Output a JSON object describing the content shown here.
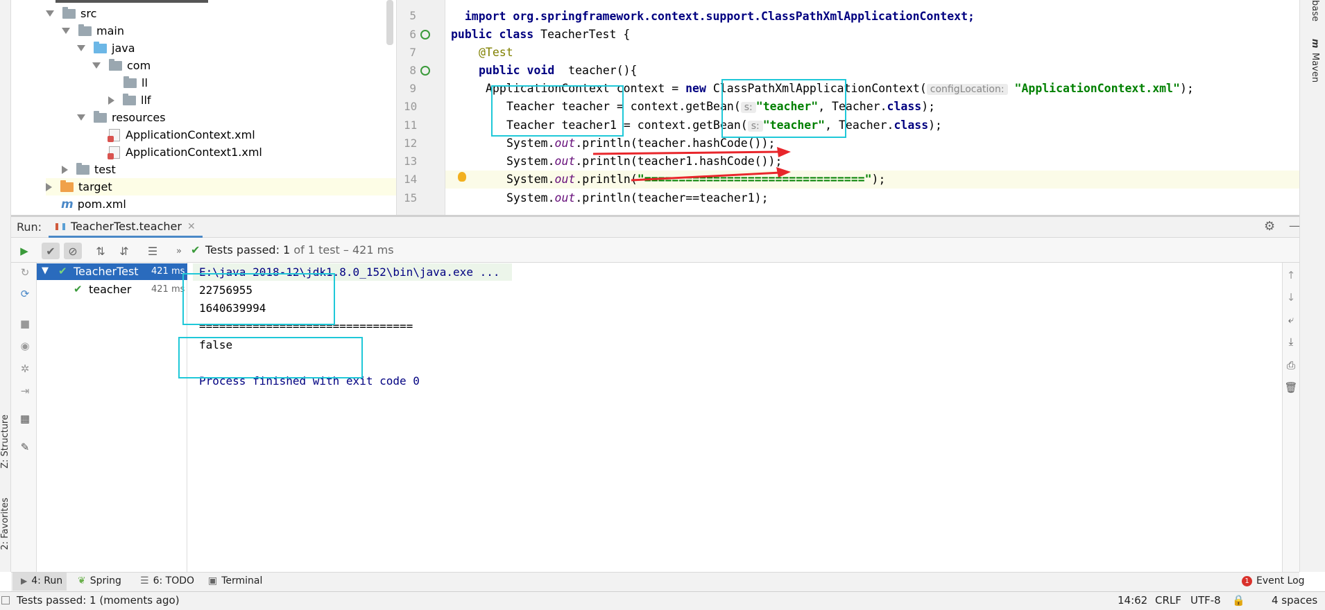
{
  "project_tree": {
    "items": [
      {
        "label": "src",
        "type": "folder-grey",
        "expanded": true
      },
      {
        "label": "main",
        "type": "folder-grey",
        "expanded": true
      },
      {
        "label": "java",
        "type": "folder-blue",
        "expanded": true
      },
      {
        "label": "com",
        "type": "package",
        "expanded": true
      },
      {
        "label": "ll",
        "type": "package"
      },
      {
        "label": "llf",
        "type": "package",
        "expanded": false
      },
      {
        "label": "resources",
        "type": "folder-res",
        "expanded": true
      },
      {
        "label": "ApplicationContext.xml",
        "type": "xml"
      },
      {
        "label": "ApplicationContext1.xml",
        "type": "xml"
      },
      {
        "label": "test",
        "type": "folder-grey",
        "expanded": false
      },
      {
        "label": "target",
        "type": "folder-orange",
        "expanded": false
      },
      {
        "label": "pom.xml",
        "type": "maven"
      }
    ]
  },
  "editor": {
    "line_numbers": [
      "5",
      "6",
      "7",
      "8",
      "9",
      "10",
      "11",
      "12",
      "13",
      "14",
      "15"
    ],
    "partial_top_line": "import org.springframework.context.support.ClassPathXmlApplicationContext;",
    "code": {
      "l6_kw": "public class ",
      "l6_rest": "TeacherTest {",
      "l7_ann": "@Test",
      "l8_kw": "public void ",
      "l8_rest": " teacher(){",
      "l9_a": "ApplicationContext context = ",
      "l9_kw": "new",
      "l9_b": " ClassPathXmlApplicationContext(",
      "l9_hint": "configLocation:",
      "l9_str": "\"ApplicationContext.xml\"",
      "l9_end": ");",
      "l10_a": "Teacher teacher = context.getBean(",
      "l10_hint": "s:",
      "l10_str": "\"teacher\"",
      "l10_b": ", Teacher.",
      "l10_kw": "class",
      "l10_end": ");",
      "l11_a": "Teacher teacher1 = context.getBean(",
      "l11_hint": "s:",
      "l11_str": "\"teacher\"",
      "l11_b": ", Teacher.",
      "l11_kw": "class",
      "l11_end": ");",
      "l12_a": "System.",
      "l12_fld": "out",
      "l12_b": ".println(teacher.hashCode());",
      "l13_a": "System.",
      "l13_fld": "out",
      "l13_b": ".println(teacher1.hashCode());",
      "l14_a": "System.",
      "l14_fld": "out",
      "l14_b": ".println(",
      "l14_str": "\"================================\"",
      "l14_end": ");",
      "l15_a": "System.",
      "l15_fld": "out",
      "l15_b": ".println(teacher==teacher1);"
    }
  },
  "run_panel": {
    "label": "Run:",
    "tab": "TeacherTest.teacher",
    "status_prefix": "Tests passed: ",
    "status_count": "1",
    "status_suffix": " of 1 test – 421 ms",
    "tree": [
      {
        "label": "TeacherTest",
        "time": "421 ms",
        "selected": true
      },
      {
        "label": "teacher",
        "time": "421 ms"
      }
    ],
    "console": {
      "cmd": "E:\\java 2018-12\\jdk1.8.0_152\\bin\\java.exe ...",
      "out1": "22756955",
      "out2": "1640639994",
      "sep": "================================",
      "result": "false",
      "finish": "Process finished with exit code 0"
    }
  },
  "bottom_tabs": {
    "run": "4: Run",
    "spring": "Spring",
    "todo": "6: TODO",
    "terminal": "Terminal",
    "event_log": "Event Log",
    "event_count": "1"
  },
  "status_bar": {
    "message": "Tests passed: 1 (moments ago)",
    "position": "14:62",
    "line_sep": "CRLF",
    "encoding": "UTF-8",
    "indent": "4 spaces"
  },
  "side_labels": {
    "structure": "Z: Structure",
    "favorites": "2: Favorites",
    "maven": "Maven",
    "database": "base"
  },
  "colors": {
    "keyword": "#000080",
    "string": "#008000",
    "annotation": "#808000",
    "field": "#660e7a",
    "selection": "#2a6bbd",
    "annotation_box": "#1fc8d8",
    "arrow": "#e8262b",
    "pass_green": "#3a9a3a"
  }
}
